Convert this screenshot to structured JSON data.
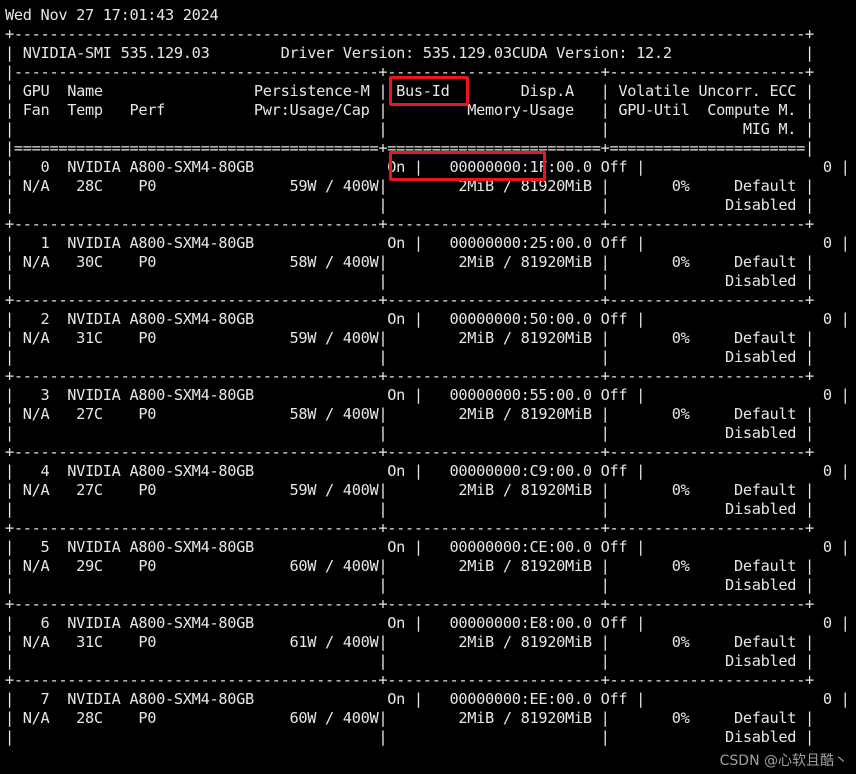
{
  "timestamp": "Wed Nov 27 17:01:43 2024",
  "header": {
    "smi_version": "NVIDIA-SMI 535.129.03",
    "driver_version": "Driver Version: 535.129.03",
    "cuda_version": "CUDA Version: 12.2"
  },
  "columns": {
    "row1": {
      "col1": "GPU  Name                 Persistence-M",
      "col2": "Bus-Id        Disp.A",
      "col3": "Volatile Uncorr. ECC"
    },
    "row2": {
      "col1": "Fan  Temp   Perf          Pwr:Usage/Cap",
      "col2": "        Memory-Usage",
      "col3": "GPU-Util  Compute M."
    },
    "row3": {
      "col1": "",
      "col2": "",
      "col3": "            MIG M."
    }
  },
  "gpus": [
    {
      "index": "0",
      "name": "NVIDIA A800-SXM4-80GB",
      "persistence": "On",
      "bus_id": "00000000:1F:00.0",
      "disp": "Off",
      "ecc": "0",
      "fan": "N/A",
      "temp": "28C",
      "perf": "P0",
      "power": "59W / 400W",
      "memory": "2MiB / 81920MiB",
      "util": "0%",
      "compute": "Default",
      "mig": "Disabled"
    },
    {
      "index": "1",
      "name": "NVIDIA A800-SXM4-80GB",
      "persistence": "On",
      "bus_id": "00000000:25:00.0",
      "disp": "Off",
      "ecc": "0",
      "fan": "N/A",
      "temp": "30C",
      "perf": "P0",
      "power": "58W / 400W",
      "memory": "2MiB / 81920MiB",
      "util": "0%",
      "compute": "Default",
      "mig": "Disabled"
    },
    {
      "index": "2",
      "name": "NVIDIA A800-SXM4-80GB",
      "persistence": "On",
      "bus_id": "00000000:50:00.0",
      "disp": "Off",
      "ecc": "0",
      "fan": "N/A",
      "temp": "31C",
      "perf": "P0",
      "power": "59W / 400W",
      "memory": "2MiB / 81920MiB",
      "util": "0%",
      "compute": "Default",
      "mig": "Disabled"
    },
    {
      "index": "3",
      "name": "NVIDIA A800-SXM4-80GB",
      "persistence": "On",
      "bus_id": "00000000:55:00.0",
      "disp": "Off",
      "ecc": "0",
      "fan": "N/A",
      "temp": "27C",
      "perf": "P0",
      "power": "58W / 400W",
      "memory": "2MiB / 81920MiB",
      "util": "0%",
      "compute": "Default",
      "mig": "Disabled"
    },
    {
      "index": "4",
      "name": "NVIDIA A800-SXM4-80GB",
      "persistence": "On",
      "bus_id": "00000000:C9:00.0",
      "disp": "Off",
      "ecc": "0",
      "fan": "N/A",
      "temp": "27C",
      "perf": "P0",
      "power": "59W / 400W",
      "memory": "2MiB / 81920MiB",
      "util": "0%",
      "compute": "Default",
      "mig": "Disabled"
    },
    {
      "index": "5",
      "name": "NVIDIA A800-SXM4-80GB",
      "persistence": "On",
      "bus_id": "00000000:CE:00.0",
      "disp": "Off",
      "ecc": "0",
      "fan": "N/A",
      "temp": "29C",
      "perf": "P0",
      "power": "60W / 400W",
      "memory": "2MiB / 81920MiB",
      "util": "0%",
      "compute": "Default",
      "mig": "Disabled"
    },
    {
      "index": "6",
      "name": "NVIDIA A800-SXM4-80GB",
      "persistence": "On",
      "bus_id": "00000000:E8:00.0",
      "disp": "Off",
      "ecc": "0",
      "fan": "N/A",
      "temp": "31C",
      "perf": "P0",
      "power": "61W / 400W",
      "memory": "2MiB / 81920MiB",
      "util": "0%",
      "compute": "Default",
      "mig": "Disabled"
    },
    {
      "index": "7",
      "name": "NVIDIA A800-SXM4-80GB",
      "persistence": "On",
      "bus_id": "00000000:EE:00.0",
      "disp": "Off",
      "ecc": "0",
      "fan": "N/A",
      "temp": "28C",
      "perf": "P0",
      "power": "60W / 400W",
      "memory": "2MiB / 81920MiB",
      "util": "0%",
      "compute": "Default",
      "mig": "Disabled"
    }
  ],
  "annotations": {
    "highlight_color": "#e8161d",
    "highlighted_items": [
      "Bus-Id",
      "00000000:1F:00.0"
    ]
  },
  "watermark": "CSDN @心软且酷丶",
  "colors": {
    "background": "#000000",
    "text": "#e6e6e6"
  }
}
